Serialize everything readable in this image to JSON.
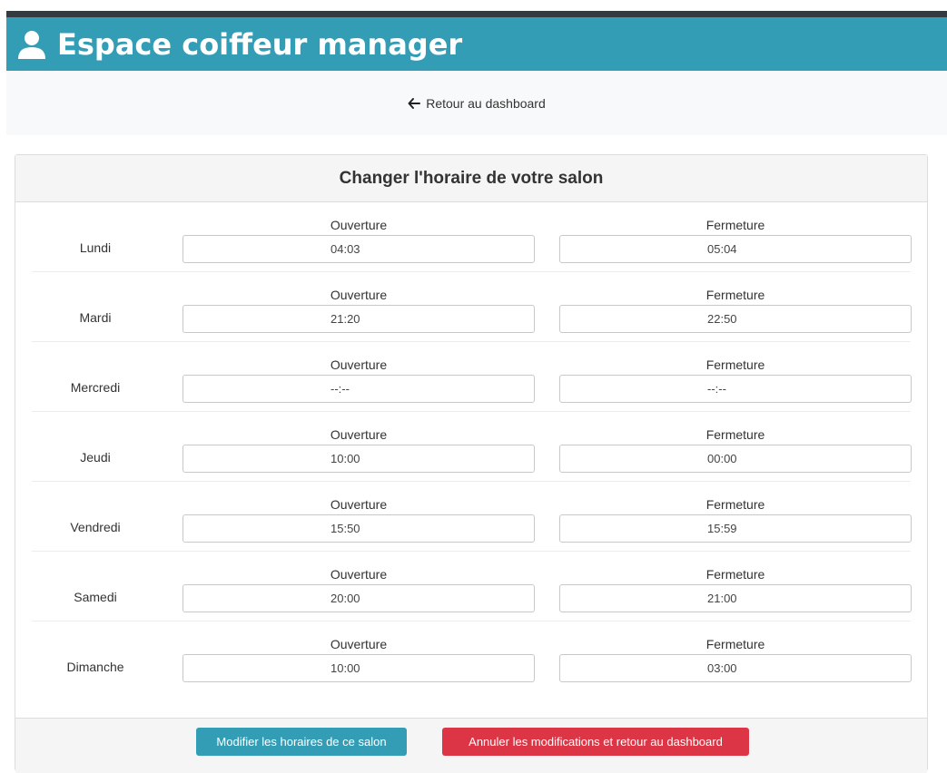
{
  "header": {
    "title": "Espace coiffeur manager",
    "icon": "user-icon"
  },
  "nav": {
    "back_label": "Retour au dashboard",
    "icon": "arrow-left-icon"
  },
  "card": {
    "title": "Changer l'horaire de votre salon"
  },
  "labels": {
    "open": "Ouverture",
    "close": "Fermeture"
  },
  "days": [
    {
      "name": "Lundi",
      "open": "04:03",
      "close": "05:04"
    },
    {
      "name": "Mardi",
      "open": "21:20",
      "close": "22:50"
    },
    {
      "name": "Mercredi",
      "open": "--:--",
      "close": "--:--"
    },
    {
      "name": "Jeudi",
      "open": "10:00",
      "close": "00:00"
    },
    {
      "name": "Vendredi",
      "open": "15:50",
      "close": "15:59"
    },
    {
      "name": "Samedi",
      "open": "20:00",
      "close": "21:00"
    },
    {
      "name": "Dimanche",
      "open": "10:00",
      "close": "03:00"
    }
  ],
  "buttons": {
    "submit": "Modifier les horaires de ce salon",
    "cancel": "Annuler les modifications et retour au dashboard"
  },
  "colors": {
    "brand": "#339db6",
    "danger": "#dc3545"
  }
}
